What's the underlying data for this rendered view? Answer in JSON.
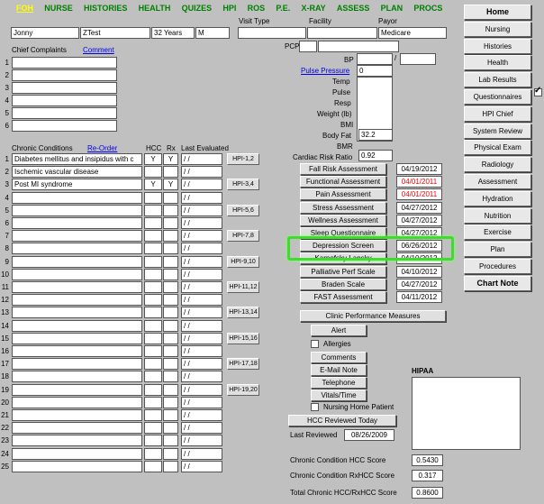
{
  "nav": [
    "FOH",
    "NURSE",
    "HISTORIES",
    "HEALTH",
    "QUIZES",
    "HPI",
    "ROS",
    "P.E.",
    "X-RAY",
    "ASSESS",
    "PLAN",
    "PROCS"
  ],
  "patient": {
    "first": "Jonny",
    "last": "ZTest",
    "age": "32 Years",
    "sex": "M"
  },
  "visit": {
    "visit_type_label": "Visit Type",
    "facility_label": "Facility",
    "payor_label": "Payor",
    "payor_value": "Medicare",
    "pcp_label": "PCP"
  },
  "complaints": {
    "label": "Chief Complaints",
    "comment_link": "Comment",
    "rows": [
      "1",
      "2",
      "3",
      "4",
      "5",
      "6"
    ]
  },
  "vitals": {
    "bp_label": "BP",
    "pulse_pressure_link": "Pulse Pressure",
    "pulse_pressure_value": "0",
    "bp_sep": "/",
    "temp_label": "Temp",
    "pulse_label": "Pulse",
    "resp_label": "Resp",
    "weight_label": "Weight (lb)",
    "bmi_label": "BMI",
    "bodyfat_label": "Body Fat",
    "bodyfat_value": "32.2",
    "bmr_label": "BMR",
    "crr_label": "Cardiac Risk Ratio",
    "crr_value": "0.92"
  },
  "conditions": {
    "label": "Chronic Conditions",
    "reorder_link": "Re-Order",
    "hcc_label": "HCC",
    "rx_label": "Rx",
    "last_eval_label": "Last Evaluated",
    "rows": [
      {
        "n": "1",
        "name": "Diabetes mellitus and insipidus with c",
        "hcc": "Y",
        "rx": "Y",
        "date": "/ /"
      },
      {
        "n": "2",
        "name": "Ischemic vascular disease",
        "hcc": "",
        "rx": "",
        "date": "/ /"
      },
      {
        "n": "3",
        "name": "Post MI syndrome",
        "hcc": "Y",
        "rx": "Y",
        "date": "/ /"
      },
      {
        "n": "4",
        "name": "",
        "hcc": "",
        "rx": "",
        "date": "/ /"
      },
      {
        "n": "5",
        "name": "",
        "hcc": "",
        "rx": "",
        "date": "/ /"
      },
      {
        "n": "6",
        "name": "",
        "hcc": "",
        "rx": "",
        "date": "/ /"
      },
      {
        "n": "7",
        "name": "",
        "hcc": "",
        "rx": "",
        "date": "/ /"
      },
      {
        "n": "8",
        "name": "",
        "hcc": "",
        "rx": "",
        "date": "/ /"
      },
      {
        "n": "9",
        "name": "",
        "hcc": "",
        "rx": "",
        "date": "/ /"
      },
      {
        "n": "10",
        "name": "",
        "hcc": "",
        "rx": "",
        "date": "/ /"
      },
      {
        "n": "11",
        "name": "",
        "hcc": "",
        "rx": "",
        "date": "/ /"
      },
      {
        "n": "12",
        "name": "",
        "hcc": "",
        "rx": "",
        "date": "/ /"
      },
      {
        "n": "13",
        "name": "",
        "hcc": "",
        "rx": "",
        "date": "/ /"
      },
      {
        "n": "14",
        "name": "",
        "hcc": "",
        "rx": "",
        "date": "/ /"
      },
      {
        "n": "15",
        "name": "",
        "hcc": "",
        "rx": "",
        "date": "/ /"
      },
      {
        "n": "16",
        "name": "",
        "hcc": "",
        "rx": "",
        "date": "/ /"
      },
      {
        "n": "17",
        "name": "",
        "hcc": "",
        "rx": "",
        "date": "/ /"
      },
      {
        "n": "18",
        "name": "",
        "hcc": "",
        "rx": "",
        "date": "/ /"
      },
      {
        "n": "19",
        "name": "",
        "hcc": "",
        "rx": "",
        "date": "/ /"
      },
      {
        "n": "20",
        "name": "",
        "hcc": "",
        "rx": "",
        "date": "/ /"
      },
      {
        "n": "21",
        "name": "",
        "hcc": "",
        "rx": "",
        "date": "/ /"
      },
      {
        "n": "22",
        "name": "",
        "hcc": "",
        "rx": "",
        "date": "/ /"
      },
      {
        "n": "23",
        "name": "",
        "hcc": "",
        "rx": "",
        "date": "/ /"
      },
      {
        "n": "24",
        "name": "",
        "hcc": "",
        "rx": "",
        "date": "/ /"
      },
      {
        "n": "25",
        "name": "",
        "hcc": "",
        "rx": "",
        "date": "/ /"
      }
    ],
    "hpi_buttons": [
      "HPI-1,2",
      "HPI-3,4",
      "HPI-5,6",
      "HPI-7,8",
      "HPI-9,10",
      "HPI-11,12",
      "HPI-13,14",
      "HPI-15,16",
      "HPI-17,18",
      "HPI-19,20"
    ]
  },
  "assessments": [
    {
      "label": "Fall Risk Assessment",
      "date": "04/19/2012",
      "red": false
    },
    {
      "label": "Functional Assessment",
      "date": "04/01/2011",
      "red": true
    },
    {
      "label": "Pain Assessment",
      "date": "04/01/2011",
      "red": true
    },
    {
      "label": "Stress Assessment",
      "date": "04/27/2012",
      "red": false
    },
    {
      "label": "Wellness Assessment",
      "date": "04/27/2012",
      "red": false
    },
    {
      "label": "Sleep Questionnaire",
      "date": "04/27/2012",
      "red": false
    },
    {
      "label": "Depression Screen",
      "date": "06/26/2012",
      "red": false
    },
    {
      "label": "Karnofsky Lansky",
      "date": "04/10/2012",
      "red": false
    },
    {
      "label": "Palliative Perf Scale",
      "date": "04/10/2012",
      "red": false
    },
    {
      "label": "Braden Scale",
      "date": "04/27/2012",
      "red": false
    },
    {
      "label": "FAST Assessment",
      "date": "04/11/2012",
      "red": false
    }
  ],
  "actions": {
    "clinic_perf": "Clinic Performance Measures",
    "alert": "Alert",
    "allergies": "Allergies",
    "comments": "Comments",
    "email_note": "E-Mail Note",
    "telephone": "Telephone",
    "vitals_time": "Vitals/Time",
    "nursing_home": "Nursing Home Patient",
    "hcc_reviewed": "HCC Reviewed Today",
    "last_reviewed_label": "Last Reviewed",
    "last_reviewed_value": "08/26/2009",
    "hipaa_label": "HIPAA"
  },
  "scores": [
    {
      "label": "Chronic Condition HCC Score",
      "value": "0.5430"
    },
    {
      "label": "Chronic Condition RxHCC Score",
      "value": "0.317"
    },
    {
      "label": "Total Chronic HCC/RxHCC Score",
      "value": "0.8600"
    }
  ],
  "sidebar": [
    "Home",
    "Nursing",
    "Histories",
    "Health",
    "Lab Results",
    "Questionnaires",
    "HPI Chief",
    "System Review",
    "Physical Exam",
    "Radiology",
    "Assessment",
    "Hydration",
    "Nutrition",
    "Exercise",
    "Plan",
    "Procedures",
    "Chart Note"
  ],
  "colors": {
    "background": "#c0c0c0",
    "nav_green": "#008000",
    "nav_active": "#ffff00",
    "alert_red": "#ff0000",
    "highlight_green": "#3ddc2e"
  }
}
